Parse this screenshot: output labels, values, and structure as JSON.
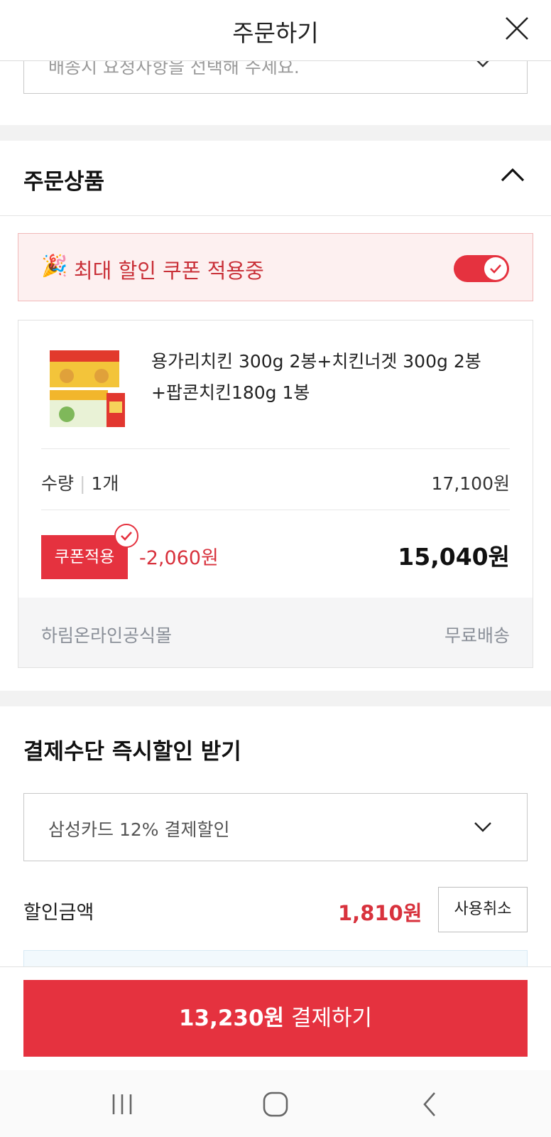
{
  "header": {
    "title": "주문하기"
  },
  "delivery": {
    "placeholder": "배송시 요청사항을 선택해 주세요."
  },
  "order_section": {
    "title": "주문상품"
  },
  "coupon_banner": {
    "emoji": "🎉",
    "label": "최대 할인 쿠폰 적용중",
    "toggle_on": true
  },
  "product": {
    "name": "용가리치킨 300g 2봉+치킨너겟 300g 2봉+팝콘치킨180g 1봉",
    "qty_label": "수량",
    "qty_value": "1개",
    "price": "17,100원",
    "coupon_button": "쿠폰적용",
    "discount": "-2,060원",
    "final_price": "15,040원",
    "seller": "하림온라인공식몰",
    "shipping": "무료배송"
  },
  "payment": {
    "title": "결제수단 즉시할인 받기",
    "selected_option": "삼성카드 12% 결제할인",
    "discount_label": "할인금액",
    "discount_amount": "1,810원",
    "cancel_button": "사용취소"
  },
  "pay_button": {
    "amount": "13,230원",
    "action": "결제하기"
  },
  "colors": {
    "accent": "#e5323f",
    "discount_text": "#d8323d",
    "banner_bg": "#fdf0f0"
  },
  "icons": [
    "close-icon",
    "chevron-down-icon",
    "chevron-up-icon",
    "party-popper-icon",
    "check-icon",
    "nav-recent-icon",
    "nav-home-icon",
    "nav-back-icon"
  ]
}
